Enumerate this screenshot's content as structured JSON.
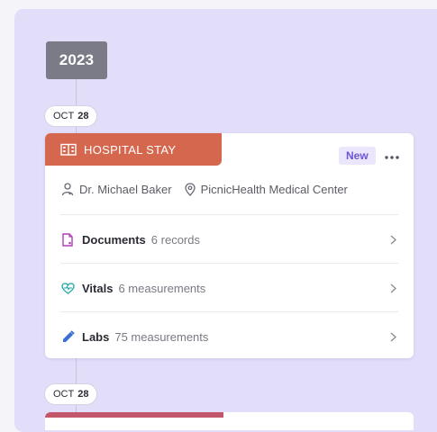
{
  "timeline": {
    "year": "2023",
    "entries": [
      {
        "month": "OCT",
        "day": "28"
      },
      {
        "month": "OCT",
        "day": "28"
      }
    ]
  },
  "card": {
    "type_label": "HOSPITAL STAY",
    "type_icon": "hospital-icon",
    "badge": "New",
    "more_icon": "more-dots-icon",
    "provider": "Dr. Michael Baker",
    "facility": "PicnicHealth Medical Center",
    "sections": [
      {
        "label": "Documents",
        "count": "6 records",
        "icon": "document-icon"
      },
      {
        "label": "Vitals",
        "count": "6 measurements",
        "icon": "heart-pulse-icon"
      },
      {
        "label": "Labs",
        "count": "75 measurements",
        "icon": "pipette-icon"
      }
    ]
  },
  "colors": {
    "panel_bg": "#e2ddf9",
    "hospital_tag": "#d5674f",
    "new_badge_text": "#6b55d9",
    "documents_icon": "#b13fb7",
    "vitals_icon": "#1aa5a0",
    "labs_icon": "#3b6fd1",
    "next_card_tag": "#c2566a"
  }
}
